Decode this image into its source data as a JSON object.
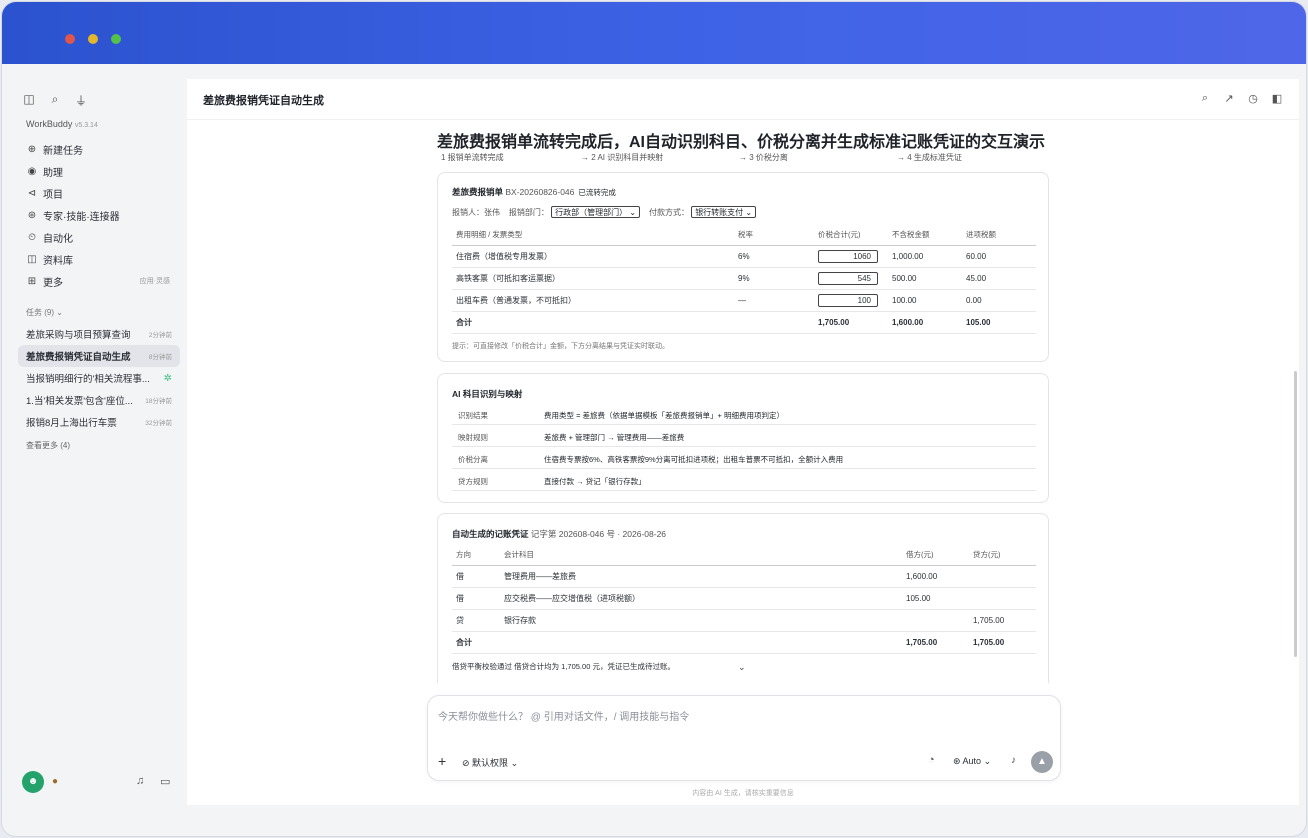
{
  "sidebar": {
    "brand": "WorkBuddy",
    "version": "v5.3.14",
    "nav": [
      {
        "label": "新建任务",
        "icon": "plus-circle-icon"
      },
      {
        "label": "助理",
        "icon": "assistant-icon"
      },
      {
        "label": "项目",
        "icon": "project-icon"
      },
      {
        "label": "专家·技能·连接器",
        "icon": "expert-icon"
      },
      {
        "label": "自动化",
        "icon": "clock-icon"
      },
      {
        "label": "资料库",
        "icon": "book-icon"
      },
      {
        "label": "更多",
        "icon": "grid-icon",
        "extra": "应用·灵感"
      }
    ],
    "tasks_header": "任务 (9)",
    "tasks": [
      {
        "label": "差旅采购与项目预算查询",
        "time": "2分钟前"
      },
      {
        "label": "差旅费报销凭证自动生成",
        "time": "8分钟前"
      },
      {
        "label": "当报销明细行的'相关流程事...",
        "time": ""
      },
      {
        "label": "1.当'相关发票'包含'座位...",
        "time": "18分钟前"
      },
      {
        "label": "报销8月上海出行车票",
        "time": "32分钟前"
      }
    ],
    "more_label": "查看更多 (4)"
  },
  "main": {
    "title": "差旅费报销凭证自动生成",
    "doc_title": "差旅费报销单流转完成后，AI自动识别科目、价税分离并生成标准记账凭证的交互演示",
    "steps": [
      "1  报销单流转完成",
      "→  2  AI 识别科目并映射",
      "→  3  价税分离",
      "→  4  生成标准凭证"
    ]
  },
  "form": {
    "title": "差旅费报销单",
    "number": "BX-20260826-046",
    "status": "已流转完成",
    "applicant_label": "报销人：张伟",
    "dept_label": "报销部门：",
    "dept_value": "行政部（管理部门）",
    "pay_label": "付款方式：",
    "pay_value": "银行转账支付",
    "headers": [
      "费用明细 / 发票类型",
      "税率",
      "价税合计(元)",
      "不含税金额",
      "进项税额"
    ],
    "rows": [
      [
        "住宿费（增值税专用发票）",
        "6%",
        "1060",
        "1,000.00",
        "60.00"
      ],
      [
        "高铁客票（可抵扣客运票据）",
        "9%",
        "545",
        "500.00",
        "45.00"
      ],
      [
        "出租车费（普通发票，不可抵扣）",
        "—",
        "100",
        "100.00",
        "0.00"
      ]
    ],
    "total": [
      "合计",
      "",
      "1,705.00",
      "1,600.00",
      "105.00"
    ],
    "hint": "提示：可直接修改「价税合计」金额，下方分离结果与凭证实时联动。"
  },
  "mapping": {
    "title": "AI 科目识别与映射",
    "rows": [
      {
        "k": "识别结果",
        "v": "费用类型 = 差旅费（依据单据模板「差旅费报销单」+ 明细费用项判定）"
      },
      {
        "k": "映射规则",
        "v": "差旅费 + 管理部门 → 管理费用——差旅费"
      },
      {
        "k": "价税分离",
        "v": "住宿费专票按6%、高铁客票按9%分离可抵扣进项税；出租车普票不可抵扣，全额计入费用"
      },
      {
        "k": "贷方规则",
        "v": "直接付款 → 贷记「银行存款」"
      }
    ]
  },
  "voucher": {
    "title": "自动生成的记账凭证",
    "sub": "记字第 202608-046 号 · 2026-08-26",
    "headers": [
      "方向",
      "会计科目",
      "借方(元)",
      "贷方(元)"
    ],
    "rows": [
      [
        "借",
        "管理费用——差旅费",
        "1,600.00",
        ""
      ],
      [
        "借",
        "应交税费——应交增值税（进项税额）",
        "105.00",
        ""
      ],
      [
        "贷",
        "银行存款",
        "",
        "1,705.00"
      ]
    ],
    "total": [
      "合计",
      "",
      "1,705.00",
      "1,705.00"
    ],
    "balance": "借贷平衡校验通过  借贷合计均为 1,705.00 元，凭证已生成待过账。"
  },
  "composer": {
    "placeholder": "今天帮你做些什么？ @ 引用对话文件，/ 调用技能与指令",
    "permission": "默认权限",
    "model": "Auto",
    "footer": "内容由 AI 生成，请核实重要信息"
  }
}
